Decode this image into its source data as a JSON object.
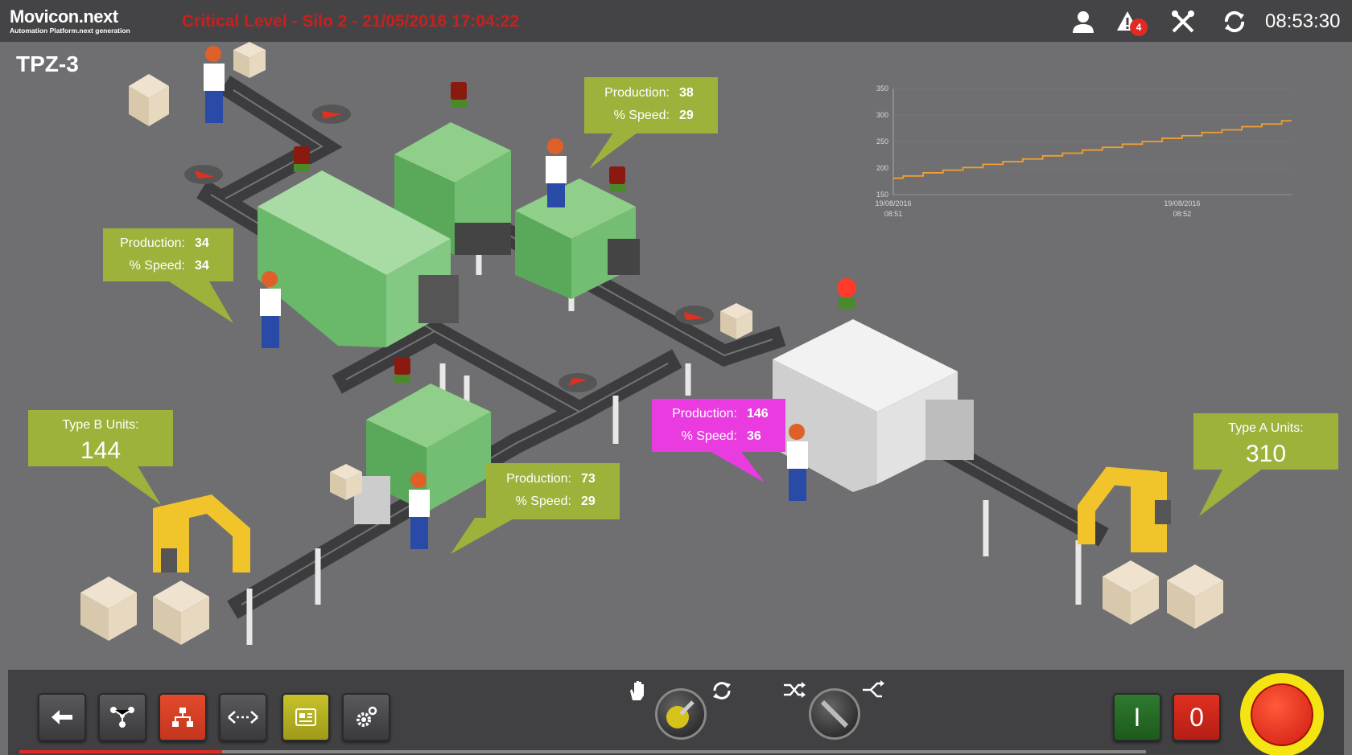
{
  "header": {
    "logo_main": "Movicon.next",
    "logo_sub": "Automation Platform.next generation",
    "alarm_message": "Critical Level - Silo 2 - 21/05/2016 17:04:22",
    "alarm_count": "4",
    "clock": "08:53:30",
    "icons": [
      "user-icon",
      "alarm-bell-icon",
      "tools-icon",
      "sync-icon"
    ]
  },
  "page": {
    "title": "TPZ-3"
  },
  "stations": [
    {
      "production_label": "Production:",
      "production": "38",
      "speed_label": "% Speed:",
      "speed": "29",
      "color": "#9cb23b"
    },
    {
      "production_label": "Production:",
      "production": "34",
      "speed_label": "% Speed:",
      "speed": "34",
      "color": "#9cb23b"
    },
    {
      "production_label": "Production:",
      "production": "73",
      "speed_label": "% Speed:",
      "speed": "29",
      "color": "#9cb23b"
    },
    {
      "production_label": "Production:",
      "production": "146",
      "speed_label": "% Speed:",
      "speed": "36",
      "color": "#e93be0"
    }
  ],
  "units": {
    "type_b": {
      "label": "Type B Units:",
      "value": "144"
    },
    "type_a": {
      "label": "Type A Units:",
      "value": "310"
    }
  },
  "chart_data": {
    "type": "line",
    "y_ticks": [
      "350",
      "300",
      "250",
      "200",
      "150"
    ],
    "ylim": [
      150,
      350
    ],
    "x_ticks": [
      {
        "date": "19/08/2016",
        "time": "08:51"
      },
      {
        "date": "19/08/2016",
        "time": "08:52"
      }
    ],
    "series": [
      {
        "color": "#f0a030",
        "x": [
          0,
          0.05,
          0.1,
          0.15,
          0.2,
          0.25,
          0.3,
          0.35,
          0.4,
          0.45,
          0.5,
          0.55,
          0.6,
          0.65,
          0.7,
          0.75,
          0.8,
          0.85,
          0.9,
          0.95,
          1.0
        ],
        "values": [
          181,
          185,
          191,
          196,
          201,
          207,
          212,
          217,
          223,
          228,
          234,
          239,
          245,
          250,
          256,
          261,
          267,
          272,
          278,
          283,
          289
        ]
      }
    ]
  },
  "controls": {
    "stop_label": "0",
    "start_label": "I",
    "progress": 0.18,
    "colors": {
      "accent_green": "#9cb23b",
      "magenta": "#e93be0",
      "alarm_red": "#c8201d"
    }
  }
}
